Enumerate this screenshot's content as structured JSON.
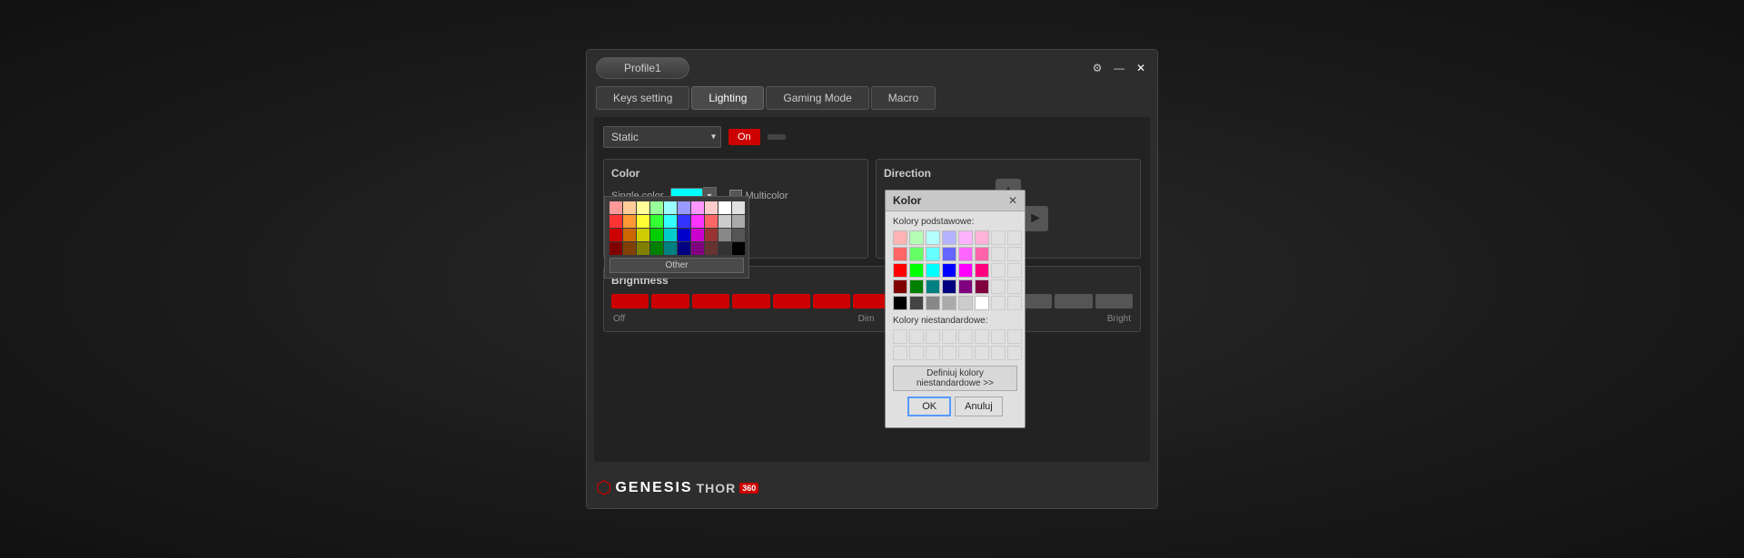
{
  "window": {
    "profile_label": "Profile1",
    "controls": {
      "settings_icon": "⚙",
      "minimize_icon": "—",
      "close_icon": "✕"
    }
  },
  "nav": {
    "tabs": [
      {
        "id": "keys",
        "label": "Keys setting",
        "active": false
      },
      {
        "id": "lighting",
        "label": "Lighting",
        "active": true
      },
      {
        "id": "gaming",
        "label": "Gaming Mode",
        "active": false
      },
      {
        "id": "macro",
        "label": "Macro",
        "active": false
      }
    ]
  },
  "mode": {
    "selected": "Static",
    "toggle_on_label": "On",
    "toggle_off_label": ""
  },
  "color_section": {
    "title": "Color",
    "single_color_label": "Single color",
    "multicolor_label": "Multicolor",
    "other_btn_label": "Other",
    "color_value": "cyan"
  },
  "direction_section": {
    "title": "Direction"
  },
  "brightness_section": {
    "title": "Brightness",
    "off_label": "Off",
    "dim_label": "Dim",
    "bright_label": "Bright",
    "active_segments": 10,
    "total_segments": 13
  },
  "kolor_dialog": {
    "title": "Kolor",
    "podstawowe_label": "Kolory podstawowe:",
    "niestandardowe_label": "Kolory niestandardowe:",
    "define_btn_label": "Definiuj kolory niestandardowe >>",
    "ok_label": "OK",
    "cancel_label": "Anuluj"
  },
  "logo": {
    "brand": "GENESIS",
    "product": "THOR",
    "badge": "360"
  },
  "colors": {
    "basic_row1": [
      "#ffb3b3",
      "#ffb3d9",
      "#e8b3ff",
      "#c8b3ff",
      "#b3c8ff",
      "#b3e8ff",
      "#b3ffff",
      "#b3ffd9"
    ],
    "basic_row2": [
      "#ff8080",
      "#ff80c0",
      "#d480ff",
      "#a080ff",
      "#80a0ff",
      "#80d0ff",
      "#80ffff",
      "#80ffb0"
    ],
    "basic_row3": [
      "#ff4040",
      "#ff40a0",
      "#c040ff",
      "#8040ff",
      "#4080ff",
      "#40b8ff",
      "#40ffff",
      "#40ff80"
    ],
    "basic_row4": [
      "#ff0000",
      "#ff0080",
      "#a000ff",
      "#6000ff",
      "#0060ff",
      "#0090ff",
      "#00ffff",
      "#00ff60"
    ],
    "basic_row5": [
      "#c00000",
      "#c00060",
      "#7800c0",
      "#4800c0",
      "#0048c0",
      "#0070c0",
      "#00c0c0",
      "#00c060"
    ],
    "basic_row6": [
      "#ff4000",
      "#ff8000",
      "#ffc000",
      "#ffff00",
      "#00ff00",
      "#00ff80",
      "#0000ff",
      "#8000ff"
    ],
    "basic_row7": [
      "#c03000",
      "#c06000",
      "#c09000",
      "#c0c000",
      "#00c000",
      "#00c060",
      "#0000c0",
      "#6000c0"
    ],
    "basic_row8": [
      "#803000",
      "#804000",
      "#806000",
      "#808000",
      "#008000",
      "#008040",
      "#000080",
      "#400080"
    ],
    "basic_row9": [
      "#000000",
      "#282828",
      "#505050",
      "#787878",
      "#a0a0a0",
      "#c8c8c8",
      "#f0f0f0",
      "#ffffff"
    ]
  }
}
